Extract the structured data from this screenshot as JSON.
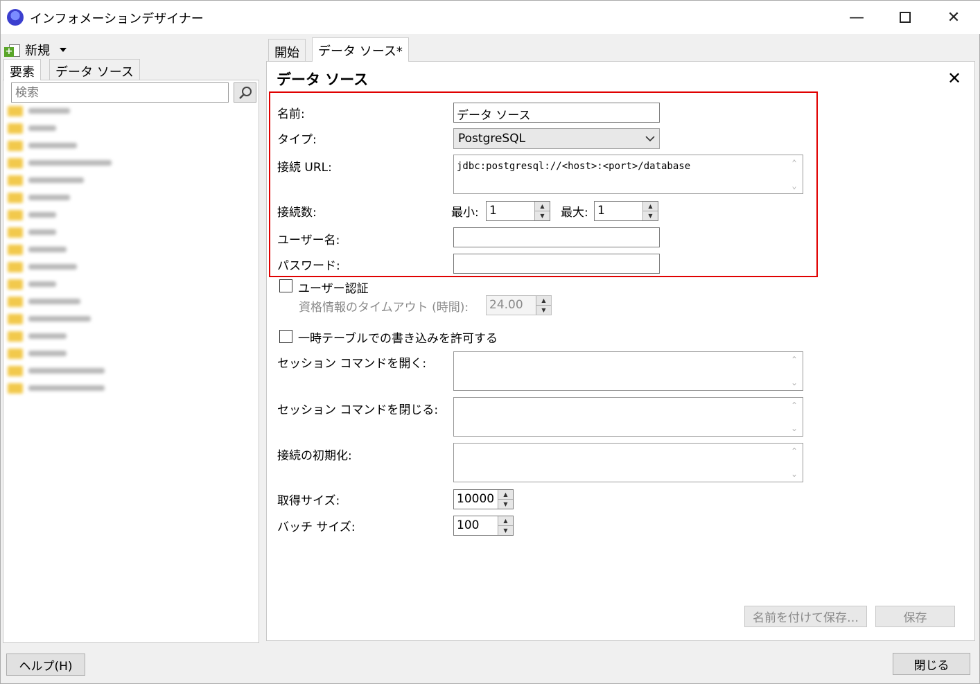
{
  "window": {
    "title": "インフォメーションデザイナー",
    "minimize_icon": "minimize-icon",
    "maximize_icon": "maximize-icon",
    "close_icon": "close-icon"
  },
  "left": {
    "new_label": "新規",
    "tabs": [
      "要素",
      "データ ソース"
    ],
    "active_tab": "要素",
    "search_placeholder": "検索"
  },
  "editor": {
    "tabs": [
      "開始",
      "データ ソース*"
    ],
    "active_tab": "データ ソース*",
    "panel_title": "データ ソース",
    "form": {
      "name_label": "名前:",
      "name_value": "データ ソース",
      "type_label": "タイプ:",
      "type_value": "PostgreSQL",
      "url_label": "接続 URL:",
      "url_value": "jdbc:postgresql://<host>:<port>/database",
      "connections_label": "接続数:",
      "min_label": "最小:",
      "min_value": "1",
      "max_label": "最大:",
      "max_value": "1",
      "username_label": "ユーザー名:",
      "username_value": "",
      "password_label": "パスワード:",
      "password_value": ""
    },
    "user_auth_label": "ユーザー認証",
    "user_auth_checked": false,
    "credential_timeout_label": "資格情報のタイムアウト (時間):",
    "credential_timeout_value": "24.00",
    "temp_table_label": "一時テーブルでの書き込みを許可する",
    "temp_table_checked": false,
    "open_session_label": "セッション コマンドを開く:",
    "close_session_label": "セッション コマンドを閉じる:",
    "init_connection_label": "接続の初期化:",
    "fetch_size_label": "取得サイズ:",
    "fetch_size_value": "10000",
    "batch_size_label": "バッチ サイズ:",
    "batch_size_value": "100",
    "save_as_label": "名前を付けて保存…",
    "save_label": "保存"
  },
  "footer": {
    "help_label": "ヘルプ(H)",
    "close_label": "閉じる"
  },
  "colors": {
    "highlight": "#e00000",
    "folder": "#f2c94c"
  }
}
